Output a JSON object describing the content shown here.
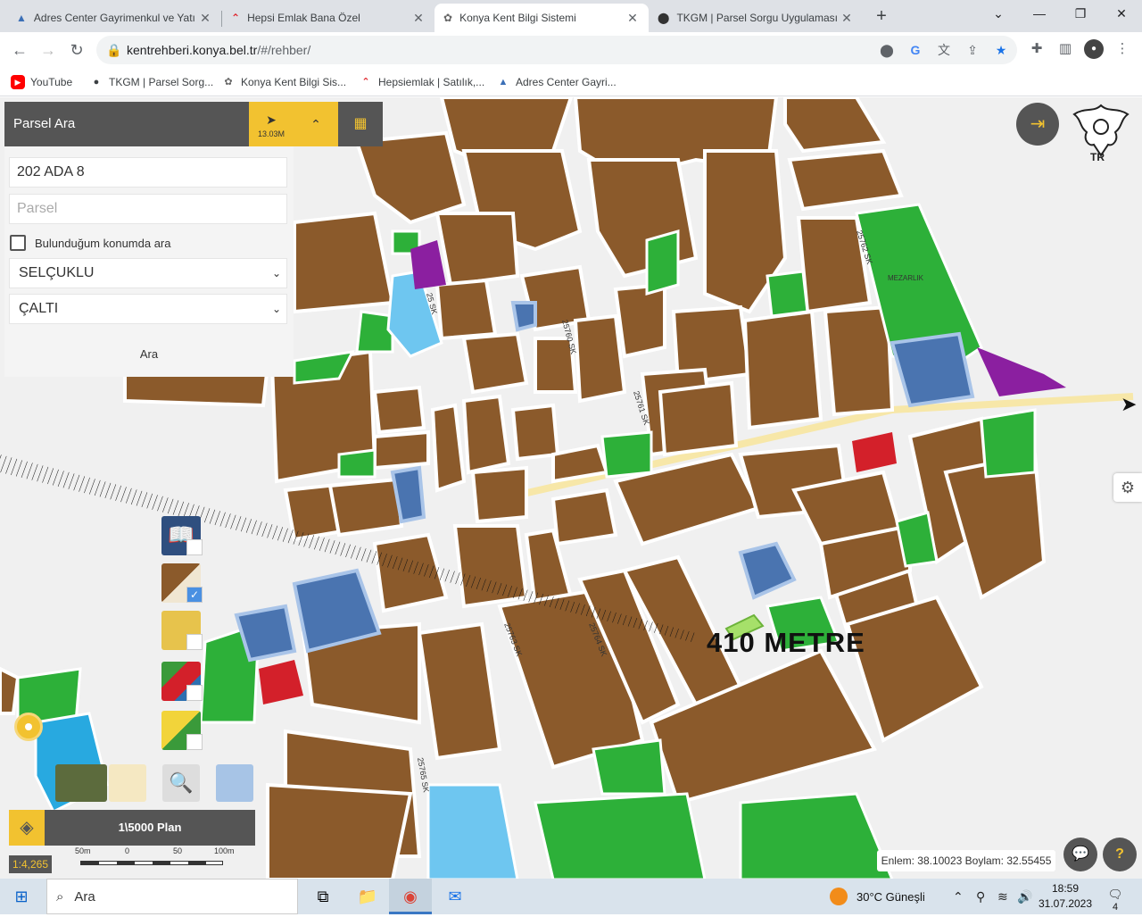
{
  "browser": {
    "tabs": [
      {
        "title": "Adres Center Gayrimenkul ve Yatı",
        "icon": "adres-center-icon",
        "active": false
      },
      {
        "title": "Hepsi Emlak Bana Özel",
        "icon": "hepsiemlak-icon",
        "active": false
      },
      {
        "title": "Konya Kent Bilgi Sistemi",
        "icon": "konya-logo-icon",
        "active": true
      },
      {
        "title": "TKGM | Parsel Sorgu Uygulaması",
        "icon": "map-pin-icon",
        "active": false
      }
    ],
    "url_host": "kentrehberi.konya.bel.tr",
    "url_path": "/#/rehber/",
    "bookmarks": [
      {
        "label": "YouTube",
        "icon": "youtube-icon"
      },
      {
        "label": "TKGM | Parsel Sorg...",
        "icon": "map-pin-icon"
      },
      {
        "label": "Konya Kent Bilgi Sis...",
        "icon": "konya-logo-icon"
      },
      {
        "label": "Hepsiemlak | Satılık,...",
        "icon": "hepsiemlak-icon"
      },
      {
        "label": "Adres Center Gayri...",
        "icon": "adres-center-icon"
      }
    ]
  },
  "panel": {
    "title": "Parsel Ara",
    "locate_distance": "13.03M",
    "ada_value": "202 ADA 8",
    "parsel_placeholder": "Parsel",
    "checkbox_label": "Bulunduğum konumda ara",
    "district": "SELÇUKLU",
    "neighborhood": "ÇALTI",
    "search_button": "Ara"
  },
  "map": {
    "distance_label": "410 METRE",
    "plan_name": "1\\5000 Plan",
    "scale_ratio": "1:4,265",
    "scale_ticks": [
      "50m",
      "0",
      "50",
      "100m"
    ],
    "coordinates": "Enlem: 38.10023 Boylam: 32.55455",
    "logo_text": "TR",
    "street_labels": [
      "25 SK",
      "25760 SK",
      "25761 SK",
      "25762 SK",
      "25763 SK",
      "25764 SK",
      "25765 SK"
    ],
    "cemetery_label": "MEZARLIK",
    "colors": {
      "parcel": "#8b5a2b",
      "green": "#2db039",
      "water": "#6ec6f0",
      "public": "#4a74b0",
      "purple": "#8b1fa0",
      "red": "#d3202a",
      "accent": "#f2c230"
    }
  },
  "taskbar": {
    "search_placeholder": "Ara",
    "weather": "30°C  Güneşli",
    "time": "18:59",
    "date": "31.07.2023",
    "notifications": "4"
  }
}
